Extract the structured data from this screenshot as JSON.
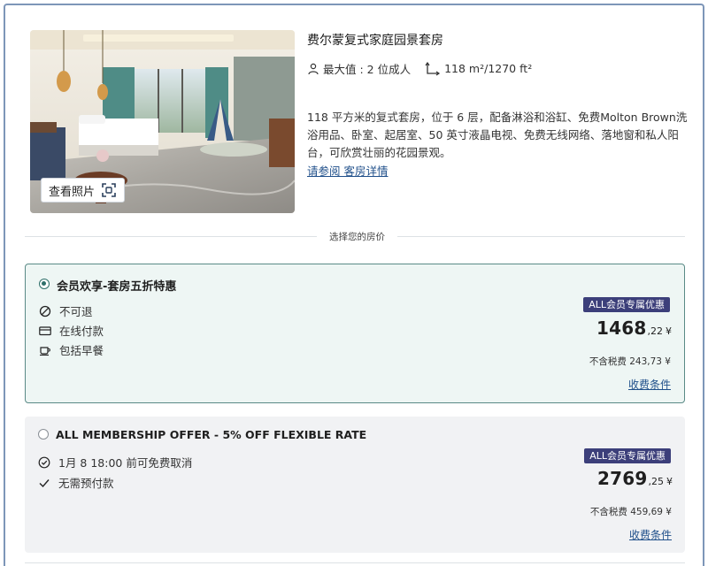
{
  "room": {
    "title": "费尔蒙复式家庭园景套房",
    "photo_button_label": "查看照片",
    "occupancy": "最大值 : 2 位成人",
    "size": "118 m²/1270 ft²",
    "description": "118 平方米的复式套房，位于 6 层，配备淋浴和浴缸、免费Molton Brown洗浴用品、卧室、起居室、50 英寸液晶电视、免费无线网络、落地窗和私人阳台，可欣赏壮丽的花园景观。",
    "details_link": "请参阅 客房详情"
  },
  "divider_label": "选择您的房价",
  "rates": [
    {
      "name": "会员欢享-套房五折特惠",
      "selected": true,
      "features": [
        {
          "icon": "no-refund-icon",
          "text": "不可退"
        },
        {
          "icon": "credit-card-icon",
          "text": "在线付款"
        },
        {
          "icon": "coffee-cup-icon",
          "text": "包括早餐"
        }
      ],
      "badge": "ALL会员专属优惠",
      "price_main": "1468",
      "price_cents": ",22",
      "currency": "¥",
      "tax_text": "不含税费 243,73 ¥",
      "terms_link": "收费条件"
    },
    {
      "name": "ALL MEMBERSHIP OFFER - 5% OFF FLEXIBLE RATE",
      "selected": false,
      "features": [
        {
          "icon": "clock-check-icon",
          "text": "1月 8 18:00 前可免费取消"
        },
        {
          "icon": "checkmark-icon",
          "text": "无需预付款"
        }
      ],
      "badge": "ALL会员专属优惠",
      "price_main": "2769",
      "price_cents": ",25",
      "currency": "¥",
      "tax_text": "不含税费 459,69 ¥",
      "terms_link": "收费条件"
    }
  ],
  "colors": {
    "selected_border": "#5a8a86",
    "selected_bg": "#eef6f4",
    "badge_bg": "#3c3f7a",
    "link": "#1f4f8a"
  }
}
